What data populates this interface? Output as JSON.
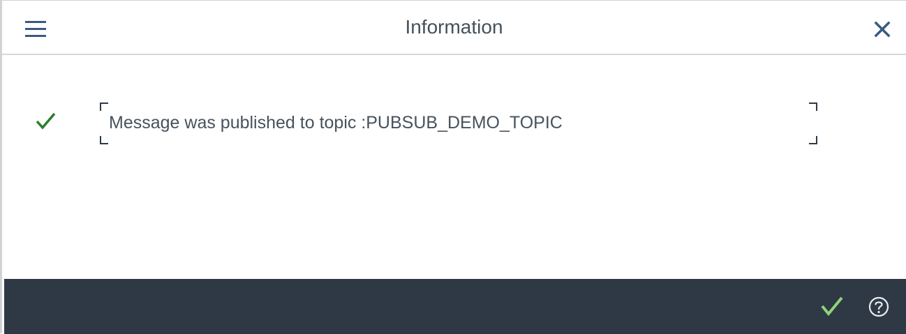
{
  "dialog": {
    "title": "Information",
    "menu_icon": "hamburger-menu-icon",
    "close_icon": "close-icon"
  },
  "message": {
    "status_icon": "checkmark-icon",
    "status": "success",
    "text": "Message was published to topic :PUBSUB_DEMO_TOPIC"
  },
  "footer": {
    "confirm_icon": "checkmark-icon",
    "help_icon": "help-icon"
  },
  "colors": {
    "title_text": "#44515c",
    "accent_blue": "#3a5a80",
    "success_green": "#2b7d2b",
    "footer_bg": "#2f3945",
    "footer_check": "#8fd47a"
  }
}
